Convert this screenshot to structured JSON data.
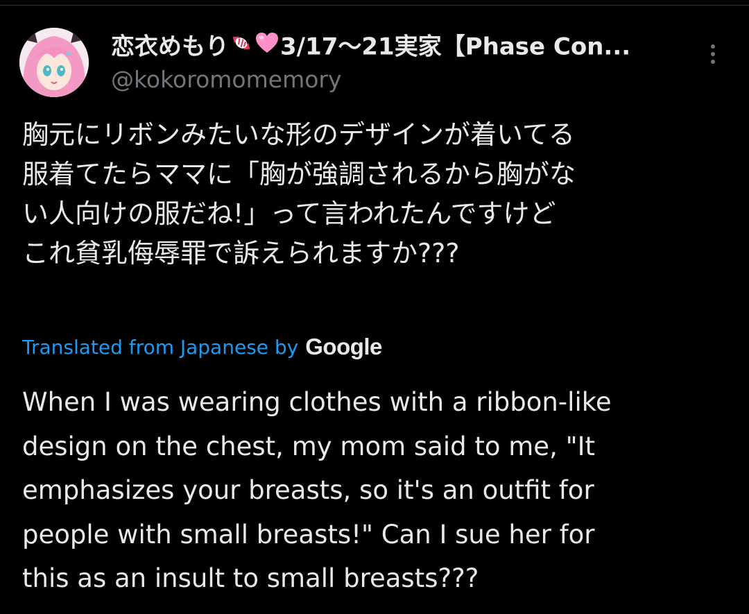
{
  "author": {
    "display_name": "恋衣めもり",
    "display_name_suffix": "3/17〜21実家【Phase Con...",
    "emojis": [
      "candy-icon",
      "pink-heart-icon"
    ],
    "handle": "@kokoromomemory"
  },
  "tweet": {
    "lines": [
      "胸元にリボンみたいな形のデザインが着いてる",
      "服着てたらママに「胸が強調されるから胸がな",
      "い人向けの服だね!」って言われたんですけど",
      "これ貧乳侮辱罪で訴えられますか???"
    ]
  },
  "translation": {
    "label": "Translated from Japanese by",
    "provider": "Google",
    "lines": [
      "When I was wearing clothes with a ribbon-like",
      "design on the chest, my mom said to me, \"It",
      "emphasizes your breasts, so it's an outfit for",
      "people with small breasts!\" Can I sue her for",
      "this as an insult to small breasts???"
    ]
  },
  "colors": {
    "background": "#000000",
    "text_primary": "#e7e9ea",
    "text_secondary": "#71767b",
    "link": "#1d9bf0",
    "heart": "#ff8fc8"
  }
}
